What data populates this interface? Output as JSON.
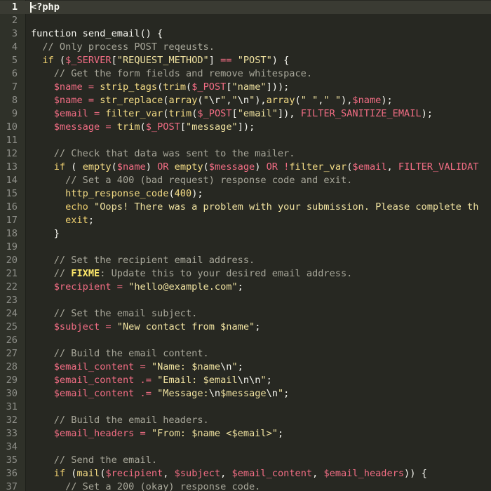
{
  "editor": {
    "language": "php",
    "current_line": 1,
    "colors": {
      "background": "#272822",
      "gutter": "#2f3129",
      "current_line": "#3a3b33",
      "comment": "#a8a79a",
      "variable": "#f26d84",
      "keyword": "#f0d170",
      "string": "#f0e2a0",
      "plain": "#f8f8f2"
    },
    "lines": [
      {
        "n": "1",
        "tokens": [
          {
            "t": "<?php",
            "k": "plain"
          }
        ]
      },
      {
        "n": "2",
        "tokens": []
      },
      {
        "n": "3",
        "tokens": [
          {
            "t": "function send_email() {",
            "k": "plain"
          }
        ]
      },
      {
        "n": "4",
        "tokens": [
          {
            "t": "  // Only process POST reqeusts.",
            "k": "comment"
          }
        ]
      },
      {
        "n": "5",
        "tokens": [
          {
            "t": "  ",
            "k": "plain"
          },
          {
            "t": "if",
            "k": "keyword"
          },
          {
            "t": " (",
            "k": "plain"
          },
          {
            "t": "$_SERVER",
            "k": "variable"
          },
          {
            "t": "[",
            "k": "plain"
          },
          {
            "t": "\"REQUEST_METHOD\"",
            "k": "string"
          },
          {
            "t": "] ",
            "k": "plain"
          },
          {
            "t": "==",
            "k": "operator"
          },
          {
            "t": " ",
            "k": "plain"
          },
          {
            "t": "\"POST\"",
            "k": "string"
          },
          {
            "t": ") {",
            "k": "plain"
          }
        ]
      },
      {
        "n": "6",
        "tokens": [
          {
            "t": "    // Get the form fields and remove whitespace.",
            "k": "comment"
          }
        ]
      },
      {
        "n": "7",
        "tokens": [
          {
            "t": "    ",
            "k": "plain"
          },
          {
            "t": "$name",
            "k": "variable"
          },
          {
            "t": " ",
            "k": "plain"
          },
          {
            "t": "=",
            "k": "operator"
          },
          {
            "t": " ",
            "k": "plain"
          },
          {
            "t": "strip_tags",
            "k": "builtin"
          },
          {
            "t": "(",
            "k": "plain"
          },
          {
            "t": "trim",
            "k": "builtin"
          },
          {
            "t": "(",
            "k": "plain"
          },
          {
            "t": "$_POST",
            "k": "variable"
          },
          {
            "t": "[",
            "k": "plain"
          },
          {
            "t": "\"name\"",
            "k": "string"
          },
          {
            "t": "]));",
            "k": "plain"
          }
        ]
      },
      {
        "n": "8",
        "tokens": [
          {
            "t": "    ",
            "k": "plain"
          },
          {
            "t": "$name",
            "k": "variable"
          },
          {
            "t": " ",
            "k": "plain"
          },
          {
            "t": "=",
            "k": "operator"
          },
          {
            "t": " ",
            "k": "plain"
          },
          {
            "t": "str_replace",
            "k": "builtin"
          },
          {
            "t": "(",
            "k": "plain"
          },
          {
            "t": "array",
            "k": "builtin"
          },
          {
            "t": "(",
            "k": "plain"
          },
          {
            "t": "\"",
            "k": "string"
          },
          {
            "t": "\\r",
            "k": "escape"
          },
          {
            "t": "\"",
            "k": "string"
          },
          {
            "t": ",",
            "k": "plain"
          },
          {
            "t": "\"",
            "k": "string"
          },
          {
            "t": "\\n",
            "k": "escape"
          },
          {
            "t": "\"",
            "k": "string"
          },
          {
            "t": "),",
            "k": "plain"
          },
          {
            "t": "array",
            "k": "builtin"
          },
          {
            "t": "(",
            "k": "plain"
          },
          {
            "t": "\" \"",
            "k": "string"
          },
          {
            "t": ",",
            "k": "plain"
          },
          {
            "t": "\" \"",
            "k": "string"
          },
          {
            "t": "),",
            "k": "plain"
          },
          {
            "t": "$name",
            "k": "variable"
          },
          {
            "t": ");",
            "k": "plain"
          }
        ]
      },
      {
        "n": "9",
        "tokens": [
          {
            "t": "    ",
            "k": "plain"
          },
          {
            "t": "$email",
            "k": "variable"
          },
          {
            "t": " ",
            "k": "plain"
          },
          {
            "t": "=",
            "k": "operator"
          },
          {
            "t": " ",
            "k": "plain"
          },
          {
            "t": "filter_var",
            "k": "builtin"
          },
          {
            "t": "(",
            "k": "plain"
          },
          {
            "t": "trim",
            "k": "builtin"
          },
          {
            "t": "(",
            "k": "plain"
          },
          {
            "t": "$_POST",
            "k": "variable"
          },
          {
            "t": "[",
            "k": "plain"
          },
          {
            "t": "\"email\"",
            "k": "string"
          },
          {
            "t": "]), ",
            "k": "plain"
          },
          {
            "t": "FILTER_SANITIZE_EMAIL",
            "k": "constant"
          },
          {
            "t": ");",
            "k": "plain"
          }
        ]
      },
      {
        "n": "10",
        "tokens": [
          {
            "t": "    ",
            "k": "plain"
          },
          {
            "t": "$message",
            "k": "variable"
          },
          {
            "t": " ",
            "k": "plain"
          },
          {
            "t": "=",
            "k": "operator"
          },
          {
            "t": " ",
            "k": "plain"
          },
          {
            "t": "trim",
            "k": "builtin"
          },
          {
            "t": "(",
            "k": "plain"
          },
          {
            "t": "$_POST",
            "k": "variable"
          },
          {
            "t": "[",
            "k": "plain"
          },
          {
            "t": "\"message\"",
            "k": "string"
          },
          {
            "t": "]);",
            "k": "plain"
          }
        ]
      },
      {
        "n": "11",
        "tokens": []
      },
      {
        "n": "12",
        "tokens": [
          {
            "t": "    // Check that data was sent to the mailer.",
            "k": "comment"
          }
        ]
      },
      {
        "n": "13",
        "tokens": [
          {
            "t": "    ",
            "k": "plain"
          },
          {
            "t": "if",
            "k": "keyword"
          },
          {
            "t": " ( ",
            "k": "plain"
          },
          {
            "t": "empty",
            "k": "builtin"
          },
          {
            "t": "(",
            "k": "plain"
          },
          {
            "t": "$name",
            "k": "variable"
          },
          {
            "t": ") ",
            "k": "plain"
          },
          {
            "t": "OR",
            "k": "operator"
          },
          {
            "t": " ",
            "k": "plain"
          },
          {
            "t": "empty",
            "k": "builtin"
          },
          {
            "t": "(",
            "k": "plain"
          },
          {
            "t": "$message",
            "k": "variable"
          },
          {
            "t": ") ",
            "k": "plain"
          },
          {
            "t": "OR",
            "k": "operator"
          },
          {
            "t": " ",
            "k": "plain"
          },
          {
            "t": "!",
            "k": "operator"
          },
          {
            "t": "filter_var",
            "k": "builtin"
          },
          {
            "t": "(",
            "k": "plain"
          },
          {
            "t": "$email",
            "k": "variable"
          },
          {
            "t": ", ",
            "k": "plain"
          },
          {
            "t": "FILTER_VALIDAT",
            "k": "constant"
          }
        ]
      },
      {
        "n": "14",
        "tokens": [
          {
            "t": "      // Set a 400 (bad request) response code and exit.",
            "k": "comment"
          }
        ]
      },
      {
        "n": "15",
        "tokens": [
          {
            "t": "      ",
            "k": "plain"
          },
          {
            "t": "http_response_code",
            "k": "builtin"
          },
          {
            "t": "(",
            "k": "plain"
          },
          {
            "t": "400",
            "k": "number"
          },
          {
            "t": ");",
            "k": "plain"
          }
        ]
      },
      {
        "n": "16",
        "tokens": [
          {
            "t": "      ",
            "k": "plain"
          },
          {
            "t": "echo",
            "k": "keyword"
          },
          {
            "t": " ",
            "k": "plain"
          },
          {
            "t": "\"Oops! There was a problem with your submission. Please complete th",
            "k": "string"
          }
        ]
      },
      {
        "n": "17",
        "tokens": [
          {
            "t": "      ",
            "k": "plain"
          },
          {
            "t": "exit",
            "k": "keyword"
          },
          {
            "t": ";",
            "k": "plain"
          }
        ]
      },
      {
        "n": "18",
        "tokens": [
          {
            "t": "    }",
            "k": "plain"
          }
        ]
      },
      {
        "n": "19",
        "tokens": []
      },
      {
        "n": "20",
        "tokens": [
          {
            "t": "    // Set the recipient email address.",
            "k": "comment"
          }
        ]
      },
      {
        "n": "21",
        "tokens": [
          {
            "t": "    // ",
            "k": "comment"
          },
          {
            "t": "FIXME",
            "k": "fixme"
          },
          {
            "t": ": Update this to your desired email address.",
            "k": "comment"
          }
        ]
      },
      {
        "n": "22",
        "tokens": [
          {
            "t": "    ",
            "k": "plain"
          },
          {
            "t": "$recipient",
            "k": "variable"
          },
          {
            "t": " ",
            "k": "plain"
          },
          {
            "t": "=",
            "k": "operator"
          },
          {
            "t": " ",
            "k": "plain"
          },
          {
            "t": "\"hello@example.com\"",
            "k": "string"
          },
          {
            "t": ";",
            "k": "plain"
          }
        ]
      },
      {
        "n": "23",
        "tokens": []
      },
      {
        "n": "24",
        "tokens": [
          {
            "t": "    // Set the email subject.",
            "k": "comment"
          }
        ]
      },
      {
        "n": "25",
        "tokens": [
          {
            "t": "    ",
            "k": "plain"
          },
          {
            "t": "$subject",
            "k": "variable"
          },
          {
            "t": " ",
            "k": "plain"
          },
          {
            "t": "=",
            "k": "operator"
          },
          {
            "t": " ",
            "k": "plain"
          },
          {
            "t": "\"New contact from ",
            "k": "string"
          },
          {
            "t": "$name",
            "k": "string"
          },
          {
            "t": "\"",
            "k": "string"
          },
          {
            "t": ";",
            "k": "plain"
          }
        ]
      },
      {
        "n": "26",
        "tokens": []
      },
      {
        "n": "27",
        "tokens": [
          {
            "t": "    // Build the email content.",
            "k": "comment"
          }
        ]
      },
      {
        "n": "28",
        "tokens": [
          {
            "t": "    ",
            "k": "plain"
          },
          {
            "t": "$email_content",
            "k": "variable"
          },
          {
            "t": " ",
            "k": "plain"
          },
          {
            "t": "=",
            "k": "operator"
          },
          {
            "t": " ",
            "k": "plain"
          },
          {
            "t": "\"Name: ",
            "k": "string"
          },
          {
            "t": "$name",
            "k": "string"
          },
          {
            "t": "\\n",
            "k": "escape"
          },
          {
            "t": "\"",
            "k": "string"
          },
          {
            "t": ";",
            "k": "plain"
          }
        ]
      },
      {
        "n": "29",
        "tokens": [
          {
            "t": "    ",
            "k": "plain"
          },
          {
            "t": "$email_content",
            "k": "variable"
          },
          {
            "t": " ",
            "k": "plain"
          },
          {
            "t": ".=",
            "k": "operator"
          },
          {
            "t": " ",
            "k": "plain"
          },
          {
            "t": "\"Email: ",
            "k": "string"
          },
          {
            "t": "$email",
            "k": "string"
          },
          {
            "t": "\\n\\n",
            "k": "escape"
          },
          {
            "t": "\"",
            "k": "string"
          },
          {
            "t": ";",
            "k": "plain"
          }
        ]
      },
      {
        "n": "30",
        "tokens": [
          {
            "t": "    ",
            "k": "plain"
          },
          {
            "t": "$email_content",
            "k": "variable"
          },
          {
            "t": " ",
            "k": "plain"
          },
          {
            "t": ".=",
            "k": "operator"
          },
          {
            "t": " ",
            "k": "plain"
          },
          {
            "t": "\"Message:",
            "k": "string"
          },
          {
            "t": "\\n",
            "k": "escape"
          },
          {
            "t": "$message",
            "k": "string"
          },
          {
            "t": "\\n",
            "k": "escape"
          },
          {
            "t": "\"",
            "k": "string"
          },
          {
            "t": ";",
            "k": "plain"
          }
        ]
      },
      {
        "n": "31",
        "tokens": []
      },
      {
        "n": "32",
        "tokens": [
          {
            "t": "    // Build the email headers.",
            "k": "comment"
          }
        ]
      },
      {
        "n": "33",
        "tokens": [
          {
            "t": "    ",
            "k": "plain"
          },
          {
            "t": "$email_headers",
            "k": "variable"
          },
          {
            "t": " ",
            "k": "plain"
          },
          {
            "t": "=",
            "k": "operator"
          },
          {
            "t": " ",
            "k": "plain"
          },
          {
            "t": "\"From: ",
            "k": "string"
          },
          {
            "t": "$name",
            "k": "string"
          },
          {
            "t": " <",
            "k": "string"
          },
          {
            "t": "$email",
            "k": "string"
          },
          {
            "t": ">\"",
            "k": "string"
          },
          {
            "t": ";",
            "k": "plain"
          }
        ]
      },
      {
        "n": "34",
        "tokens": []
      },
      {
        "n": "35",
        "tokens": [
          {
            "t": "    // Send the email.",
            "k": "comment"
          }
        ]
      },
      {
        "n": "36",
        "tokens": [
          {
            "t": "    ",
            "k": "plain"
          },
          {
            "t": "if",
            "k": "keyword"
          },
          {
            "t": " (",
            "k": "plain"
          },
          {
            "t": "mail",
            "k": "builtin"
          },
          {
            "t": "(",
            "k": "plain"
          },
          {
            "t": "$recipient",
            "k": "variable"
          },
          {
            "t": ", ",
            "k": "plain"
          },
          {
            "t": "$subject",
            "k": "variable"
          },
          {
            "t": ", ",
            "k": "plain"
          },
          {
            "t": "$email_content",
            "k": "variable"
          },
          {
            "t": ", ",
            "k": "plain"
          },
          {
            "t": "$email_headers",
            "k": "variable"
          },
          {
            "t": ")) {",
            "k": "plain"
          }
        ]
      },
      {
        "n": "37",
        "tokens": [
          {
            "t": "      // Set a 200 (okay) response code.",
            "k": "comment"
          }
        ]
      }
    ]
  }
}
